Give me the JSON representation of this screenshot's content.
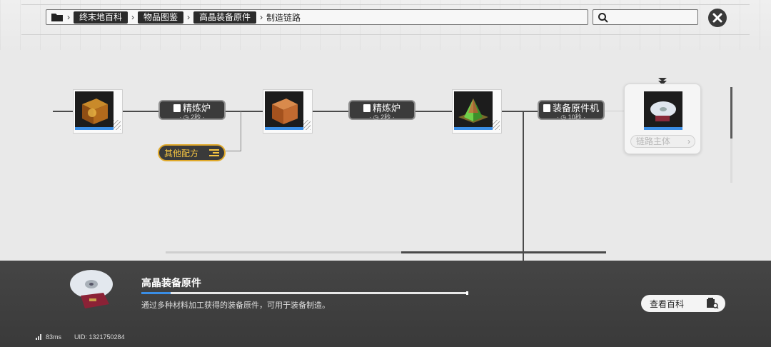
{
  "breadcrumb": {
    "items": [
      "终末地百科",
      "物品图鉴",
      "高晶装备原件"
    ],
    "current": "制造链路"
  },
  "search": {
    "value": "",
    "placeholder": ""
  },
  "chain": {
    "machines": [
      {
        "name": "精炼炉",
        "time": "2秒"
      },
      {
        "name": "精炼炉",
        "time": "2秒"
      },
      {
        "name": "装备原件机",
        "time": "10秒"
      }
    ],
    "other_recipes_label": "其他配方",
    "target_button_label": "链路主体"
  },
  "info": {
    "name": "高晶装备原件",
    "description": "通过多种材料加工获得的装备原件，可用于装备制造。",
    "progress": 0.09,
    "wiki_button_label": "查看百科"
  },
  "status": {
    "ping": "83ms",
    "uid": "UID: 1321750284"
  },
  "colors": {
    "accent_blue": "#3a8ee6",
    "recipe_orange": "#e0a92a",
    "panel_dark": "#3f3f3f"
  }
}
